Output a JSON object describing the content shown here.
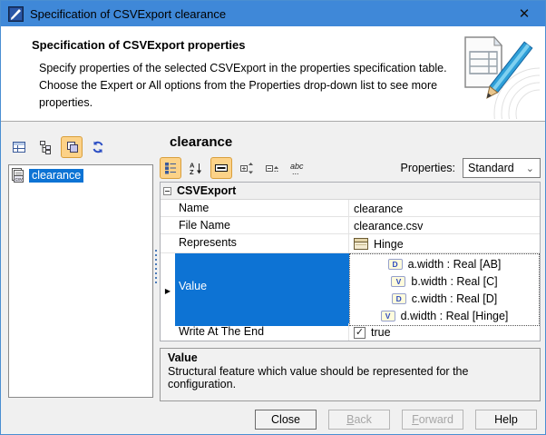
{
  "window": {
    "title": "Specification of CSVExport clearance",
    "close_glyph": "✕"
  },
  "colors": {
    "titlebar": "#3f88d8",
    "selection_blue": "#0d73d4",
    "toolbar_highlight": "#fcd288",
    "dialog_border": "#4a8ed2"
  },
  "header": {
    "title": "Specification of CSVExport properties",
    "description": "Specify properties of the selected CSVExport in the properties specification table. Choose the Expert or All options from the Properties drop-down list to see more properties.",
    "art": "document-with-pencil-illustration"
  },
  "left_panel": {
    "toolbar": [
      {
        "icon": "properties-table-icon",
        "selected": false
      },
      {
        "icon": "containment-tree-icon",
        "selected": false
      },
      {
        "icon": "composite-squares-icon",
        "selected": true
      },
      {
        "icon": "refresh-icon",
        "selected": false
      }
    ],
    "tree": {
      "items": [
        {
          "label": "clearance",
          "icon": "csv-export-element-icon",
          "selected": true
        }
      ]
    }
  },
  "right_panel": {
    "title": "clearance",
    "toolbar": {
      "icons": [
        "categorized-view-icon",
        "sort-alphabetically-icon",
        "show-description-icon",
        "expand-nodes-icon",
        "collapse-nodes-icon",
        "abc-edit-icon"
      ],
      "properties_label": "Properties:",
      "properties_value": "Standard"
    },
    "table": {
      "group_label": "CSVExport",
      "rows": [
        {
          "label": "Name",
          "value": "clearance"
        },
        {
          "label": "File Name",
          "value": "clearance.csv"
        },
        {
          "label": "Represents",
          "value": "Hinge",
          "value_icon": "block-icon"
        },
        {
          "label": "Value",
          "selected": true,
          "marker": "▶",
          "items": [
            {
              "badge": "D",
              "text": "a.width : Real [AB]"
            },
            {
              "badge": "V",
              "text": "b.width : Real [C]"
            },
            {
              "badge": "D",
              "text": "c.width : Real [D]"
            },
            {
              "badge": "V",
              "text": "d.width : Real [Hinge]"
            }
          ]
        },
        {
          "label": "Write At The End",
          "value": "true",
          "checked": true,
          "check_glyph": "✓"
        }
      ]
    },
    "description": {
      "title": "Value",
      "text": "Structural feature which value should be represented for the configuration."
    }
  },
  "footer": {
    "buttons": [
      {
        "label": "Close",
        "enabled": true
      },
      {
        "label_u": "B",
        "label_rest": "ack",
        "enabled": false
      },
      {
        "label_u": "F",
        "label_rest": "orward",
        "enabled": false
      },
      {
        "label": "Help",
        "enabled": true
      }
    ]
  }
}
